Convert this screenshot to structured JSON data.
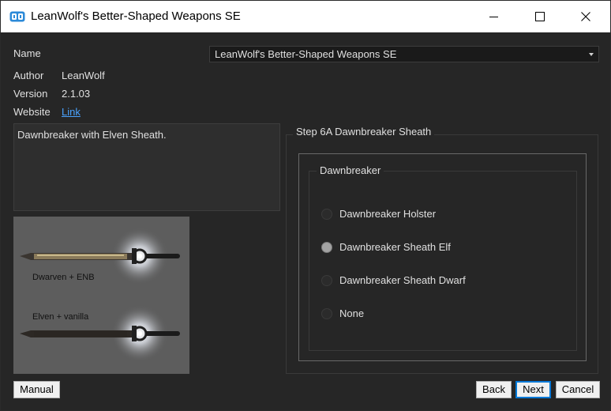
{
  "window": {
    "title": "LeanWolf's Better-Shaped Weapons SE"
  },
  "info": {
    "name_label": "Name",
    "name_value": "LeanWolf's Better-Shaped Weapons SE",
    "author_label": "Author",
    "author_value": "LeanWolf",
    "version_label": "Version",
    "version_value": "2.1.03",
    "website_label": "Website",
    "website_link": "Link"
  },
  "description": "Dawnbreaker with Elven Sheath.",
  "preview": {
    "top_caption": "Dwarven + ENB",
    "bottom_caption": "Elven + vanilla"
  },
  "step": {
    "title": "Step 6A Dawnbreaker Sheath",
    "group_title": "Dawnbreaker",
    "options": [
      {
        "label": "Dawnbreaker Holster",
        "selected": false
      },
      {
        "label": "Dawnbreaker Sheath Elf",
        "selected": true
      },
      {
        "label": "Dawnbreaker Sheath Dwarf",
        "selected": false
      },
      {
        "label": "None",
        "selected": false
      }
    ]
  },
  "buttons": {
    "manual": "Manual",
    "back": "Back",
    "next": "Next",
    "cancel": "Cancel"
  },
  "colors": {
    "background": "#262626",
    "link": "#4aa3ff",
    "accent": "#0078d7"
  }
}
